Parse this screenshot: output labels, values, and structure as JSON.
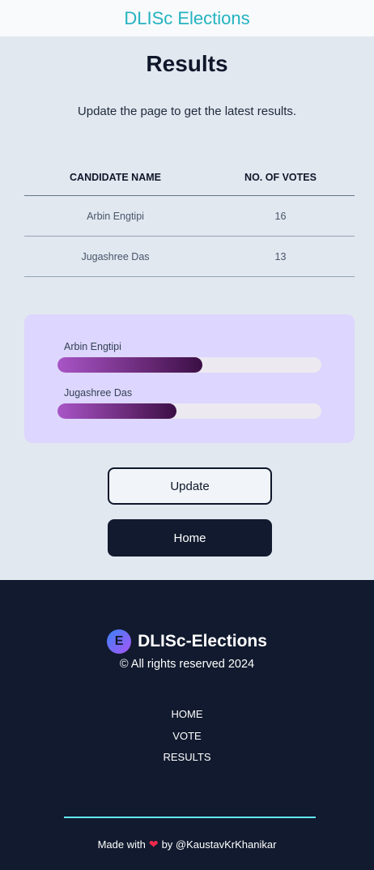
{
  "header": {
    "brand": "DLISc Elections"
  },
  "main": {
    "title": "Results",
    "subtitle": "Update the page to get the latest results."
  },
  "table": {
    "columns": [
      "CANDIDATE NAME",
      "NO. OF VOTES"
    ],
    "rows": [
      {
        "name": "Arbin Engtipi",
        "votes": "16"
      },
      {
        "name": "Jugashree Das",
        "votes": "13"
      }
    ]
  },
  "bars": [
    {
      "label": "Arbin Engtipi",
      "fraction": 0.55
    },
    {
      "label": "Jugashree Das",
      "fraction": 0.45
    }
  ],
  "buttons": {
    "update": "Update",
    "home": "Home"
  },
  "footer": {
    "logo_letter": "E",
    "brand": "DLISc-Elections",
    "copyright": "© All rights reserved 2024",
    "nav": [
      "HOME",
      "VOTE",
      "RESULTS"
    ],
    "made_prefix": "Made with",
    "made_suffix": "by @KaustavKrKhanikar",
    "heart_icon": "heart-icon"
  },
  "colors": {
    "brand": "#23b3c0",
    "dark": "#111a2e",
    "card": "#ddd6fe",
    "divider": "#67e8f9"
  }
}
